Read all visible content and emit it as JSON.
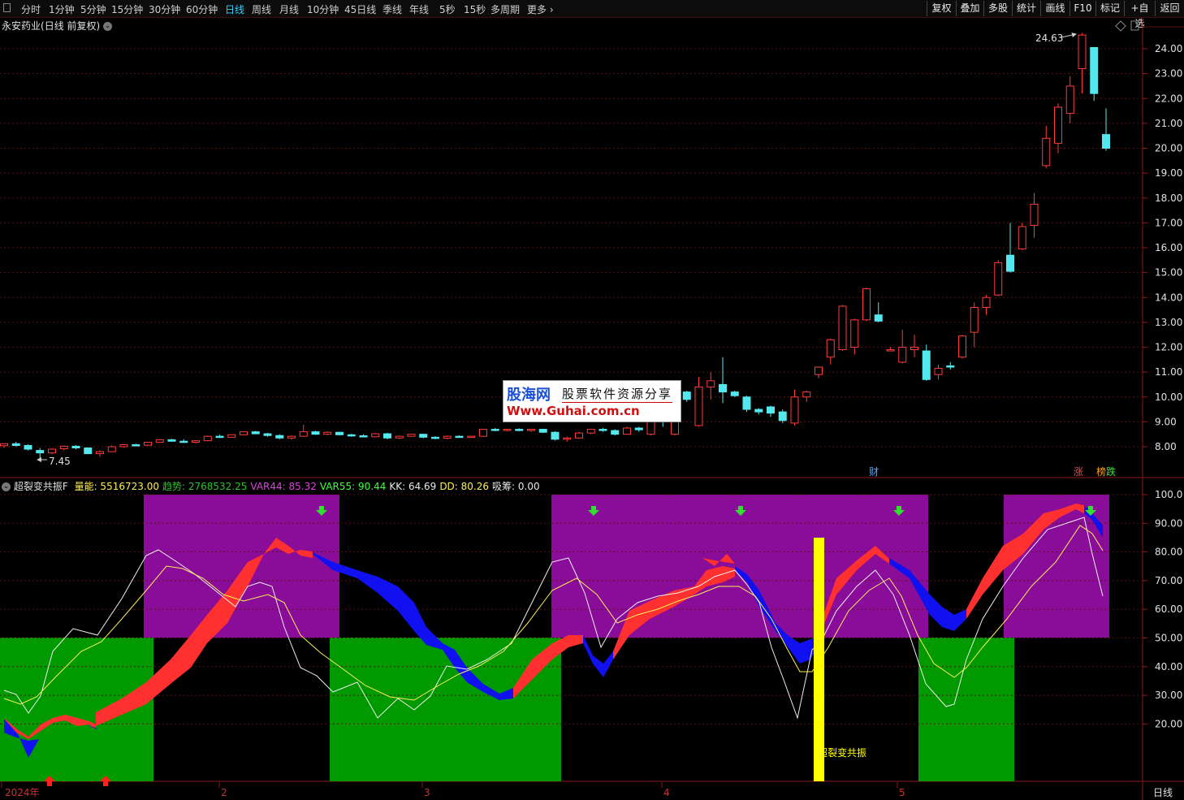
{
  "toolbar": {
    "periods": [
      "分时",
      "1分钟",
      "5分钟",
      "15分钟",
      "30分钟",
      "60分钟",
      "日线",
      "周线",
      "月线",
      "10分钟",
      "45日线",
      "季线",
      "年线",
      "5秒",
      "15秒",
      "多周期",
      "更多"
    ],
    "active_period": "日线",
    "right_buttons": [
      "复权",
      "叠加",
      "多股",
      "统计",
      "画线",
      "F10",
      "标记",
      "+自选",
      "返回"
    ]
  },
  "main_chart": {
    "stock_name": "永安药业",
    "mode": "(日线 前复权)",
    "high_label": "24.63",
    "low_label": "7.45",
    "price_ticks": [
      "24.00",
      "23.00",
      "22.00",
      "21.00",
      "20.00",
      "19.00",
      "18.00",
      "17.00",
      "16.00",
      "15.00",
      "14.00",
      "13.00",
      "12.00",
      "11.00",
      "10.00",
      "9.00",
      "8.00"
    ],
    "markers": {
      "cai": "财",
      "zhang": "涨",
      "bang": "榜",
      "die": "跌"
    }
  },
  "logo": {
    "name": "股海网",
    "slogan": "股票软件资源分享",
    "url": "Www.Guhai.com.cn"
  },
  "indicator": {
    "name": "超裂变共振F",
    "stats": [
      {
        "label": "量能",
        "value": "5516723.00",
        "color": "#ffee55"
      },
      {
        "label": "趋势",
        "value": "2768532.25",
        "color": "#2ec02e"
      },
      {
        "label": "VAR44",
        "value": "85.32",
        "color": "#e040e0"
      },
      {
        "label": "VAR55",
        "value": "90.44",
        "color": "#40ff40"
      },
      {
        "label": "KK",
        "value": "64.69",
        "color": "#e8e8e8"
      },
      {
        "label": "DD",
        "value": "80.26",
        "color": "#ffee55"
      },
      {
        "label": "吸筹",
        "value": "0.00",
        "color": "#e8e8e8"
      }
    ],
    "ticks": [
      "100.0",
      "90.00",
      "80.00",
      "70.00",
      "60.00",
      "50.00",
      "40.00",
      "30.00",
      "20.00"
    ],
    "signal_text": "超裂变共振"
  },
  "date_axis": {
    "labels": [
      "2024年",
      "2",
      "3",
      "4",
      "5"
    ],
    "period_label": "日线"
  },
  "colors": {
    "up": "#ff3b3b",
    "down": "#52e8ee",
    "purple_zone": "#8a0d9a",
    "green_zone": "#009a00",
    "ribbon_up": "#ff3030",
    "ribbon_down": "#1010f0",
    "signal": "#ffff00"
  },
  "chart_data": {
    "type": "candlestick",
    "ylim": [
      7.45,
      24.63
    ],
    "candles": [
      {
        "o": 8.04,
        "h": 8.14,
        "l": 7.95,
        "c": 8.12
      },
      {
        "o": 8.12,
        "h": 8.2,
        "l": 8.0,
        "c": 8.05
      },
      {
        "o": 8.05,
        "h": 8.1,
        "l": 7.85,
        "c": 7.9
      },
      {
        "o": 7.85,
        "h": 7.95,
        "l": 7.45,
        "c": 7.75
      },
      {
        "o": 7.75,
        "h": 7.95,
        "l": 7.7,
        "c": 7.9
      },
      {
        "o": 7.92,
        "h": 8.05,
        "l": 7.85,
        "c": 8.02
      },
      {
        "o": 8.02,
        "h": 8.06,
        "l": 7.9,
        "c": 7.95
      },
      {
        "o": 7.95,
        "h": 7.98,
        "l": 7.7,
        "c": 7.72
      },
      {
        "o": 7.72,
        "h": 7.85,
        "l": 7.6,
        "c": 7.8
      },
      {
        "o": 7.8,
        "h": 8.05,
        "l": 7.78,
        "c": 8.0
      },
      {
        "o": 8.0,
        "h": 8.1,
        "l": 7.96,
        "c": 8.08
      },
      {
        "o": 8.08,
        "h": 8.12,
        "l": 8.02,
        "c": 8.06
      },
      {
        "o": 8.06,
        "h": 8.2,
        "l": 8.04,
        "c": 8.18
      },
      {
        "o": 8.18,
        "h": 8.3,
        "l": 8.15,
        "c": 8.28
      },
      {
        "o": 8.28,
        "h": 8.32,
        "l": 8.2,
        "c": 8.22
      },
      {
        "o": 8.22,
        "h": 8.3,
        "l": 8.15,
        "c": 8.18
      },
      {
        "o": 8.18,
        "h": 8.26,
        "l": 8.14,
        "c": 8.24
      },
      {
        "o": 8.24,
        "h": 8.45,
        "l": 8.22,
        "c": 8.42
      },
      {
        "o": 8.42,
        "h": 8.48,
        "l": 8.35,
        "c": 8.38
      },
      {
        "o": 8.38,
        "h": 8.5,
        "l": 8.36,
        "c": 8.48
      },
      {
        "o": 8.48,
        "h": 8.62,
        "l": 8.45,
        "c": 8.6
      },
      {
        "o": 8.6,
        "h": 8.64,
        "l": 8.5,
        "c": 8.52
      },
      {
        "o": 8.52,
        "h": 8.56,
        "l": 8.4,
        "c": 8.45
      },
      {
        "o": 8.45,
        "h": 8.5,
        "l": 8.3,
        "c": 8.35
      },
      {
        "o": 8.35,
        "h": 8.45,
        "l": 8.3,
        "c": 8.42
      },
      {
        "o": 8.42,
        "h": 8.88,
        "l": 8.4,
        "c": 8.6
      },
      {
        "o": 8.6,
        "h": 8.64,
        "l": 8.48,
        "c": 8.5
      },
      {
        "o": 8.5,
        "h": 8.62,
        "l": 8.46,
        "c": 8.58
      },
      {
        "o": 8.58,
        "h": 8.6,
        "l": 8.45,
        "c": 8.48
      },
      {
        "o": 8.48,
        "h": 8.52,
        "l": 8.4,
        "c": 8.44
      },
      {
        "o": 8.44,
        "h": 8.5,
        "l": 8.38,
        "c": 8.4
      },
      {
        "o": 8.4,
        "h": 8.55,
        "l": 8.38,
        "c": 8.52
      },
      {
        "o": 8.52,
        "h": 8.56,
        "l": 8.3,
        "c": 8.35
      },
      {
        "o": 8.35,
        "h": 8.45,
        "l": 8.3,
        "c": 8.42
      },
      {
        "o": 8.42,
        "h": 8.52,
        "l": 8.4,
        "c": 8.5
      },
      {
        "o": 8.5,
        "h": 8.52,
        "l": 8.34,
        "c": 8.38
      },
      {
        "o": 8.38,
        "h": 8.42,
        "l": 8.3,
        "c": 8.34
      },
      {
        "o": 8.34,
        "h": 8.45,
        "l": 8.3,
        "c": 8.42
      },
      {
        "o": 8.42,
        "h": 8.46,
        "l": 8.36,
        "c": 8.4
      },
      {
        "o": 8.4,
        "h": 8.44,
        "l": 8.36,
        "c": 8.42
      },
      {
        "o": 8.42,
        "h": 8.72,
        "l": 8.4,
        "c": 8.7
      },
      {
        "o": 8.7,
        "h": 8.75,
        "l": 8.62,
        "c": 8.66
      },
      {
        "o": 8.66,
        "h": 8.72,
        "l": 8.62,
        "c": 8.7
      },
      {
        "o": 8.7,
        "h": 8.74,
        "l": 8.62,
        "c": 8.65
      },
      {
        "o": 8.65,
        "h": 8.72,
        "l": 8.6,
        "c": 8.7
      },
      {
        "o": 8.7,
        "h": 8.72,
        "l": 8.55,
        "c": 8.58
      },
      {
        "o": 8.58,
        "h": 8.62,
        "l": 8.25,
        "c": 8.3
      },
      {
        "o": 8.3,
        "h": 8.4,
        "l": 8.2,
        "c": 8.35
      },
      {
        "o": 8.35,
        "h": 8.6,
        "l": 8.32,
        "c": 8.55
      },
      {
        "o": 8.55,
        "h": 8.72,
        "l": 8.5,
        "c": 8.7
      },
      {
        "o": 8.7,
        "h": 8.75,
        "l": 8.6,
        "c": 8.65
      },
      {
        "o": 8.65,
        "h": 8.7,
        "l": 8.45,
        "c": 8.5
      },
      {
        "o": 8.5,
        "h": 8.8,
        "l": 8.48,
        "c": 8.75
      },
      {
        "o": 8.75,
        "h": 8.8,
        "l": 8.6,
        "c": 8.68
      },
      {
        "o": 8.5,
        "h": 9.35,
        "l": 8.45,
        "c": 9.3
      },
      {
        "o": 9.4,
        "h": 9.5,
        "l": 8.8,
        "c": 9.3
      },
      {
        "o": 8.5,
        "h": 10.3,
        "l": 8.45,
        "c": 10.2
      },
      {
        "o": 10.2,
        "h": 10.25,
        "l": 9.8,
        "c": 9.9
      },
      {
        "o": 8.85,
        "h": 10.8,
        "l": 8.8,
        "c": 10.4
      },
      {
        "o": 10.4,
        "h": 11.0,
        "l": 9.9,
        "c": 10.65
      },
      {
        "o": 10.5,
        "h": 11.6,
        "l": 9.75,
        "c": 10.2
      },
      {
        "o": 10.2,
        "h": 10.25,
        "l": 10.0,
        "c": 10.05
      },
      {
        "o": 10.0,
        "h": 10.05,
        "l": 9.4,
        "c": 9.5
      },
      {
        "o": 9.5,
        "h": 9.55,
        "l": 9.3,
        "c": 9.4
      },
      {
        "o": 9.6,
        "h": 9.65,
        "l": 9.2,
        "c": 9.35
      },
      {
        "o": 9.4,
        "h": 9.5,
        "l": 8.95,
        "c": 9.05
      },
      {
        "o": 8.95,
        "h": 10.3,
        "l": 8.85,
        "c": 10.0
      },
      {
        "o": 10.0,
        "h": 10.25,
        "l": 9.8,
        "c": 10.2
      },
      {
        "o": 10.9,
        "h": 11.2,
        "l": 10.75,
        "c": 11.2
      },
      {
        "o": 11.6,
        "h": 12.35,
        "l": 11.3,
        "c": 12.3
      },
      {
        "o": 11.9,
        "h": 13.7,
        "l": 11.85,
        "c": 13.65
      },
      {
        "o": 12.0,
        "h": 13.15,
        "l": 11.7,
        "c": 13.1
      },
      {
        "o": 13.1,
        "h": 14.4,
        "l": 13.05,
        "c": 14.35
      },
      {
        "o": 13.3,
        "h": 13.8,
        "l": 13.0,
        "c": 13.05
      },
      {
        "o": 11.9,
        "h": 12.0,
        "l": 11.85,
        "c": 11.9
      },
      {
        "o": 11.4,
        "h": 12.7,
        "l": 11.35,
        "c": 12.0
      },
      {
        "o": 11.9,
        "h": 12.5,
        "l": 11.6,
        "c": 12.0
      },
      {
        "o": 11.85,
        "h": 12.1,
        "l": 10.65,
        "c": 10.7
      },
      {
        "o": 10.9,
        "h": 11.3,
        "l": 10.7,
        "c": 11.15
      },
      {
        "o": 11.25,
        "h": 11.4,
        "l": 11.1,
        "c": 11.2
      },
      {
        "o": 11.6,
        "h": 12.5,
        "l": 11.55,
        "c": 12.45
      },
      {
        "o": 12.6,
        "h": 13.8,
        "l": 12.0,
        "c": 13.6
      },
      {
        "o": 13.6,
        "h": 14.1,
        "l": 13.3,
        "c": 14.0
      },
      {
        "o": 14.1,
        "h": 15.5,
        "l": 14.05,
        "c": 15.4
      },
      {
        "o": 15.7,
        "h": 17.0,
        "l": 15.0,
        "c": 15.05
      },
      {
        "o": 15.95,
        "h": 17.0,
        "l": 15.9,
        "c": 16.85
      },
      {
        "o": 16.9,
        "h": 18.2,
        "l": 16.4,
        "c": 17.75
      },
      {
        "o": 19.3,
        "h": 20.9,
        "l": 19.2,
        "c": 20.4
      },
      {
        "o": 20.2,
        "h": 21.8,
        "l": 19.8,
        "c": 21.65
      },
      {
        "o": 21.4,
        "h": 22.9,
        "l": 21.0,
        "c": 22.5
      },
      {
        "o": 23.2,
        "h": 24.63,
        "l": 22.2,
        "c": 24.55
      },
      {
        "o": 24.05,
        "h": 24.05,
        "l": 21.9,
        "c": 22.2
      },
      {
        "o": 20.55,
        "h": 21.6,
        "l": 19.9,
        "c": 20.0
      }
    ]
  }
}
